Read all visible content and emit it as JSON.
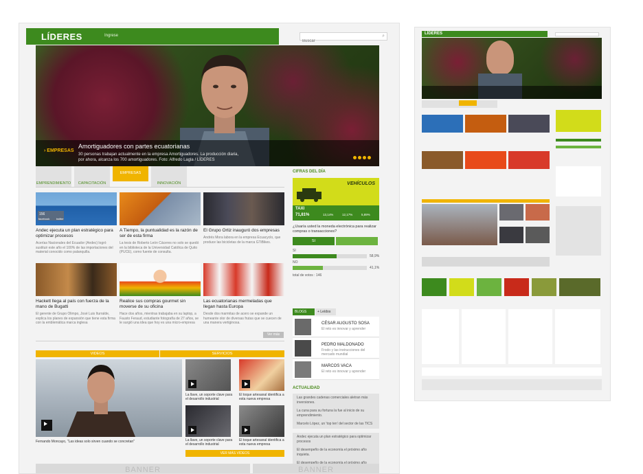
{
  "header": {
    "logo": "LÍDERES",
    "login": "Ingrese",
    "search_placeholder": "Buscar",
    "search_icon": "search-icon"
  },
  "hero": {
    "tag": "› EMPRESAS",
    "headline": "Amortiguadores con partes ecuatorianas",
    "subtext": "30 personas trabajan actualmente en la empresa Amortiguadores. La producción diaria, por ahora, alcanza los 700 amortiguadores. Foto: Alfredo Lagla / LÍDERES"
  },
  "tabs": [
    {
      "label": "EMPRENDIMIENTO"
    },
    {
      "label": "CAPACITACIÓN"
    },
    {
      "label": "EMPRESAS"
    },
    {
      "label": "INNOVACIÓN"
    }
  ],
  "articles": [
    {
      "title": "Andec ejecuta un plan estratégico para optimizar procesos",
      "text": "Acerías Nacionales del Ecuador (Andec) logró sustituir este año el 100% de las importaciones del material conocido como palanquilla.",
      "likes": "156",
      "fb": "facebook",
      "tw": "twitter"
    },
    {
      "title": "A Tiempo, la puntualidad es la razón de ser de esta firma",
      "text": "La tesis de Roberto León Cáceres no solo se quedó en la biblioteca de la Universidad Católica de Quito (PUCE), como fuente de consulta."
    },
    {
      "title": "El Grupo Ortiz inauguró dos empresas",
      "text": "Andrés Mora labora en la empresa Ecuacyclo, que produce las bicicletas de la marca GTiBikes."
    },
    {
      "title": "Hackett llega al país con fuerza de la mano de Bugatti",
      "text": "El gerente de Grupo Olimpo, José Luis Iturralde, explica los planes de expansión que tiene esta firma con la emblemática marca inglesa"
    },
    {
      "title": "Realice sus compras gourmet sin moverse de su oficina",
      "text": "Hace dos años, mientras trabajaba en su laptop, a Fausto Feraud, estudiante fotografía de 27 años, se le surgió una idea que hoy es una micro-empresa"
    },
    {
      "title": "Las ecuatorianas mermeladas que llegan hasta Europa",
      "text": "Desde dos marmitas de acero se expande un humeante olor de diversas frutas que se cuecen de una manera vertiginosa."
    }
  ],
  "more_label": "Ver más",
  "cifras": {
    "heading": "CIFRAS DEL DÍA",
    "title": "VEHÍCULOS",
    "stats": [
      {
        "label": "TAXI",
        "value": "71,81%"
      },
      {
        "label": "TRANSPORTE PESADO",
        "value": "13,14%"
      },
      {
        "label": "TRANSPORTE PÚBLICO",
        "value": "12,17%"
      },
      {
        "label": "TRANSPORTE PRIVADO",
        "value": "5,89%"
      }
    ]
  },
  "poll": {
    "question": "¿Usaría usted la moneda electrónica para realizar compras o transacciones?",
    "yes_label": "SI",
    "no_label": "NO",
    "yes_pct": "58,9%",
    "no_pct": "41,1%",
    "yes_value": 58.9,
    "no_value": 41.1,
    "total": "total de votos : 146"
  },
  "blogs": {
    "tab_blogs": "BLOGS",
    "tab_leidos": "+ Leídos",
    "items": [
      {
        "name": "CÉSAR AUGUSTO SOSA",
        "desc": "El reto es innovar y aprender"
      },
      {
        "name": "PEDRO MALDONADO",
        "desc": "Frodo y las instrucciones del mercado mundial"
      },
      {
        "name": "MARCOS VACA",
        "desc": "El reto es innovar y aprender"
      }
    ]
  },
  "actualidad": {
    "heading": "ACTUALIDAD",
    "items": [
      "Las grandes cadenas comerciales aletran más inversiones.",
      "La cuna para su fortuna la fue al inicio de su emprendimiento.",
      "Marcelo López, un 'top ten' del sector de las TICS",
      "Andec ejecuta un plan estratégico para optimizar procesos",
      "El desempeño de la economía el próximo año inquieta.",
      "El desempeño de la economía el próximo año inquieta."
    ]
  },
  "videos": {
    "tab_videos": "VIDEOS",
    "tab_servicios": "SERVICIOS",
    "main_caption": "Fernando Moncayo, \"Las ideas solo sirven cuando se concretan\"",
    "thumbs": [
      {
        "caption": "La llave, un soporte clave para el desarrollo industrial"
      },
      {
        "caption": "El toque artesanal identifica a esta nueva empresa"
      },
      {
        "caption": "La llave, un soporte clave para el desarrollo industrial"
      },
      {
        "caption": "El toque artesanal identifica a esta nueva empresa"
      }
    ],
    "more": "VER MÁS VIDEOS"
  },
  "banner": "BANNER",
  "colors": {
    "green": "#3d8a1e",
    "yellow": "#f0b400",
    "lime": "#d2dc1a"
  }
}
